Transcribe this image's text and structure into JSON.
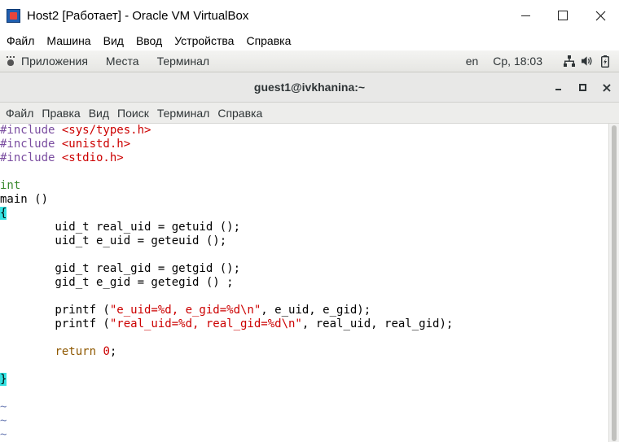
{
  "vbox": {
    "title": "Host2 [Работает] - Oracle VM VirtualBox",
    "menu": [
      "Файл",
      "Машина",
      "Вид",
      "Ввод",
      "Устройства",
      "Справка"
    ]
  },
  "gnome_panel": {
    "left_items": [
      "Приложения",
      "Места",
      "Терминал"
    ],
    "language": "en",
    "clock": "Ср, 18:03"
  },
  "terminal": {
    "title": "guest1@ivkhanina:~",
    "close_glyph": "×",
    "menu": [
      "Файл",
      "Правка",
      "Вид",
      "Поиск",
      "Терминал",
      "Справка"
    ]
  },
  "code": {
    "inc1": "#include ",
    "inc1_file": "<sys/types.h>",
    "inc2": "#include ",
    "inc2_file": "<unistd.h>",
    "inc3": "#include ",
    "inc3_file": "<stdio.h>",
    "ret_type": "int",
    "func": "main ()",
    "open_brace": "{",
    "l_uid": "        uid_t real_uid = getuid ();",
    "l_euid": "        uid_t e_uid = geteuid ();",
    "l_gid": "        gid_t real_gid = getgid ();",
    "l_egid": "        gid_t e_gid = getegid () ;",
    "p1_a": "        printf (",
    "p1_s": "\"e_uid=%d, e_gid=%d\\n\"",
    "p1_b": ", e_uid, e_gid);",
    "p2_a": "        printf (",
    "p2_s": "\"real_uid=%d, real_gid=%d\\n\"",
    "p2_b": ", real_uid, real_gid);",
    "ret_indent": "        ",
    "ret_kw": "return",
    "ret_sp": " ",
    "ret_num": "0",
    "ret_semi": ";",
    "close_brace": "}",
    "tilde": "~"
  }
}
